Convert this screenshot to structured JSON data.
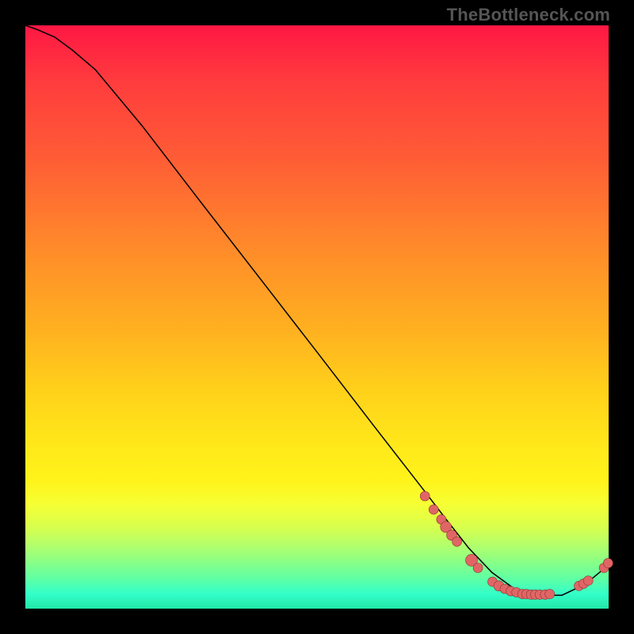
{
  "watermark": "TheBottleneck.com",
  "colors": {
    "dot_fill": "#e06666",
    "dot_stroke": "#8f2f2f",
    "curve": "#000000",
    "frame": "#000000"
  },
  "chart_data": {
    "type": "line",
    "title": "",
    "xlabel": "",
    "ylabel": "",
    "xlim": [
      0,
      100
    ],
    "ylim": [
      0,
      100
    ],
    "grid": false,
    "legend": false,
    "series": [
      {
        "name": "curve",
        "x": [
          0,
          2,
          5,
          8,
          12,
          20,
          30,
          40,
          50,
          60,
          68,
          72,
          76,
          80,
          84,
          88,
          92,
          96,
          100
        ],
        "y": [
          100,
          99.3,
          98.0,
          95.8,
          92.4,
          82.8,
          69.8,
          56.9,
          44.0,
          31.0,
          20.7,
          15.5,
          10.4,
          6.2,
          3.3,
          2.3,
          2.3,
          4.2,
          7.5
        ],
        "note": "y is % height from bottom; values estimated from pixel positions"
      }
    ],
    "markers": [
      {
        "x": 68.5,
        "y": 19.3,
        "r": 6.0
      },
      {
        "x": 70.0,
        "y": 17.0,
        "r": 6.0
      },
      {
        "x": 71.3,
        "y": 15.3,
        "r": 6.0
      },
      {
        "x": 72.1,
        "y": 14.0,
        "r": 7.0
      },
      {
        "x": 73.1,
        "y": 12.6,
        "r": 6.5
      },
      {
        "x": 74.0,
        "y": 11.5,
        "r": 6.0
      },
      {
        "x": 76.5,
        "y": 8.3,
        "r": 7.5
      },
      {
        "x": 77.6,
        "y": 7.0,
        "r": 6.0
      },
      {
        "x": 80.1,
        "y": 4.6,
        "r": 6.0
      },
      {
        "x": 81.2,
        "y": 3.9,
        "r": 6.5
      },
      {
        "x": 82.2,
        "y": 3.4,
        "r": 6.0
      },
      {
        "x": 83.2,
        "y": 3.0,
        "r": 6.0
      },
      {
        "x": 84.2,
        "y": 2.8,
        "r": 6.0
      },
      {
        "x": 85.2,
        "y": 2.5,
        "r": 6.0
      },
      {
        "x": 85.9,
        "y": 2.5,
        "r": 6.0
      },
      {
        "x": 86.7,
        "y": 2.4,
        "r": 6.0
      },
      {
        "x": 87.4,
        "y": 2.4,
        "r": 6.0
      },
      {
        "x": 88.2,
        "y": 2.4,
        "r": 6.0
      },
      {
        "x": 89.1,
        "y": 2.4,
        "r": 6.0
      },
      {
        "x": 89.9,
        "y": 2.5,
        "r": 6.0
      },
      {
        "x": 94.9,
        "y": 3.9,
        "r": 6.0
      },
      {
        "x": 95.7,
        "y": 4.3,
        "r": 6.0
      },
      {
        "x": 96.5,
        "y": 4.8,
        "r": 6.0
      },
      {
        "x": 99.2,
        "y": 7.0,
        "r": 6.0
      },
      {
        "x": 99.9,
        "y": 7.8,
        "r": 6.0
      }
    ]
  }
}
